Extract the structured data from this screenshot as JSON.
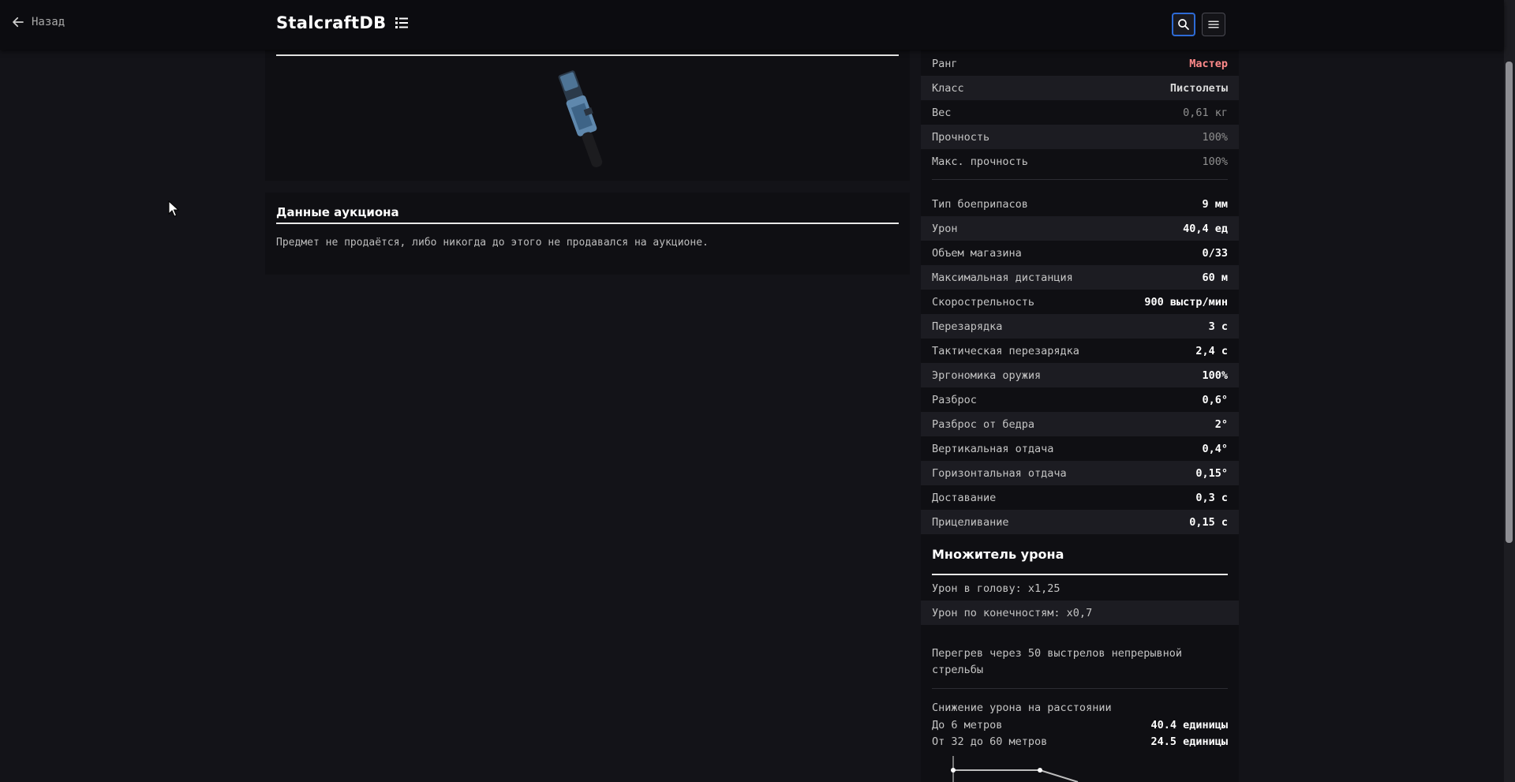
{
  "header": {
    "back_label": "Назад",
    "brand": "StalcraftDB"
  },
  "auction": {
    "title": "Данные аукциона",
    "message": "Предмет не продаётся, либо никогда до этого не продавался на аукционе."
  },
  "stats_top": [
    {
      "label": "Ранг",
      "value": "Мастер"
    },
    {
      "label": "Класс",
      "value": "Пистолеты"
    },
    {
      "label": "Вес",
      "value": "0,61 кг"
    },
    {
      "label": "Прочность",
      "value": "100%"
    },
    {
      "label": "Макс. прочность",
      "value": "100%"
    }
  ],
  "stats_weapon": [
    {
      "label": "Тип боеприпасов",
      "value": "9 мм"
    },
    {
      "label": "Урон",
      "value": "40,4 ед"
    },
    {
      "label": "Объем магазина",
      "value": "0/33"
    },
    {
      "label": "Максимальная дистанция",
      "value": "60 м"
    },
    {
      "label": "Скорострельность",
      "value": "900 выстр/мин"
    },
    {
      "label": "Перезарядка",
      "value": "3 с"
    },
    {
      "label": "Тактическая перезарядка",
      "value": "2,4 с"
    },
    {
      "label": "Эргономика оружия",
      "value": "100%"
    },
    {
      "label": "Разброс",
      "value": "0,6°"
    },
    {
      "label": "Разброс от бедра",
      "value": "2°"
    },
    {
      "label": "Вертикальная отдача",
      "value": "0,4°"
    },
    {
      "label": "Горизонтальная отдача",
      "value": "0,15°"
    },
    {
      "label": "Доставание",
      "value": "0,3 с"
    },
    {
      "label": "Прицеливание",
      "value": "0,15 с"
    }
  ],
  "multiplier": {
    "title": "Множитель урона",
    "head": "Урон в голову: x1,25",
    "limbs": "Урон по конечностям: x0,7"
  },
  "overheat": "Перегрев через 50 выстрелов непрерывной стрельбы",
  "falloff": {
    "title": "Снижение урона на расстоянии",
    "rows": [
      {
        "label": "До 6 метров",
        "value": "40.4 единицы"
      },
      {
        "label": "От 32 до 60 метров",
        "value": "24.5 единицы"
      }
    ]
  },
  "colors": {
    "rank": "#ff8a8a",
    "accent_focus": "#2d6bd6",
    "background": "#131318"
  },
  "icons": [
    "arrow-left-icon",
    "list-icon",
    "search-icon",
    "menu-icon",
    "pistol-image"
  ]
}
